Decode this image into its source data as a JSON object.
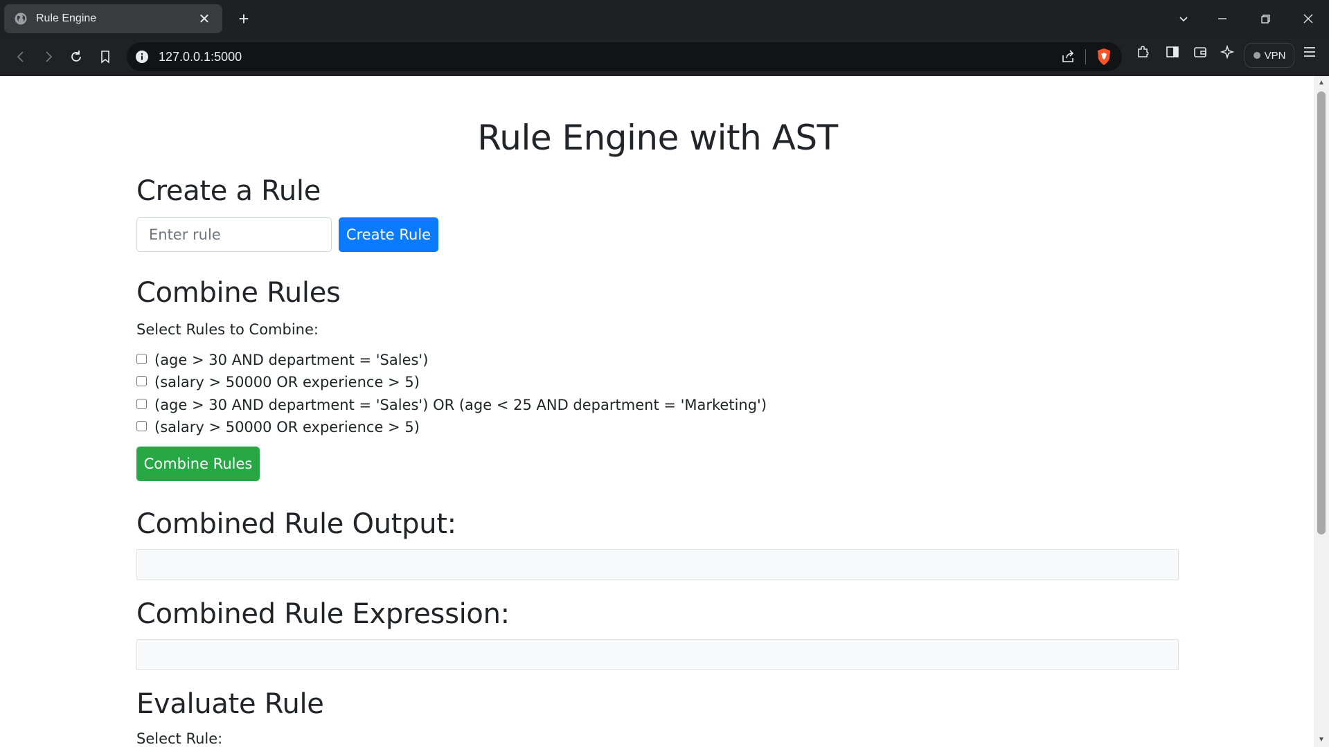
{
  "browser": {
    "tab_title": "Rule Engine",
    "url": "127.0.0.1:5000",
    "vpn_label": "VPN"
  },
  "page": {
    "title": "Rule Engine with AST",
    "create": {
      "heading": "Create a Rule",
      "input_placeholder": "Enter rule",
      "input_value": "",
      "button_label": "Create Rule"
    },
    "combine": {
      "heading": "Combine Rules",
      "select_label": "Select Rules to Combine:",
      "rules": [
        "(age > 30 AND department = 'Sales')",
        "(salary > 50000 OR experience > 5)",
        "(age > 30 AND department = 'Sales') OR (age < 25 AND department = 'Marketing')",
        "(salary > 50000 OR experience > 5)"
      ],
      "button_label": "Combine Rules"
    },
    "output": {
      "heading": "Combined Rule Output:",
      "value": ""
    },
    "expression": {
      "heading": "Combined Rule Expression:",
      "value": ""
    },
    "evaluate": {
      "heading": "Evaluate Rule",
      "select_label": "Select Rule:"
    }
  },
  "colors": {
    "primary": "#0a7bff",
    "success": "#28a745",
    "text": "#212529"
  }
}
